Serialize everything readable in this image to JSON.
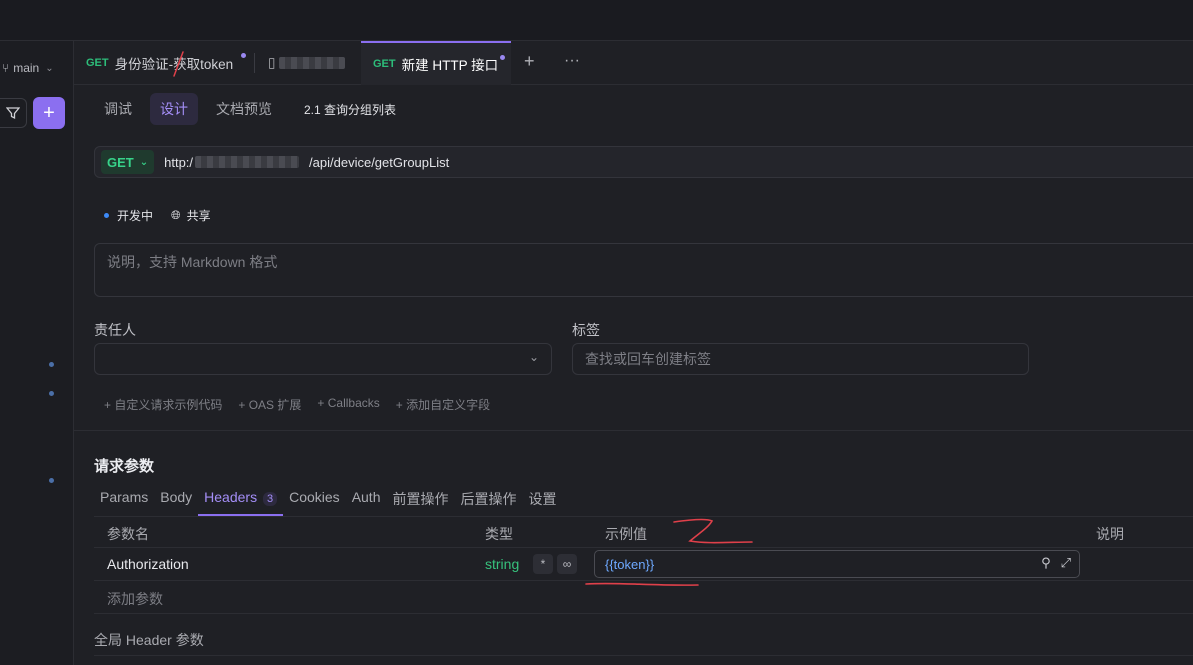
{
  "sidebar": {
    "branch": "main",
    "add_label": "+"
  },
  "tabs": [
    {
      "method": "GET",
      "title": "身份验证-获取token"
    },
    {
      "method": "",
      "title": ""
    },
    {
      "method": "GET",
      "title": "新建 HTTP 接口"
    }
  ],
  "tab_actions": {
    "add": "+",
    "more": "···"
  },
  "subtabs": [
    "调试",
    "设计",
    "文档预览"
  ],
  "breadcrumb": "2.1 查询分组列表",
  "request": {
    "method": "GET",
    "url_prefix": "http:/",
    "url_path": "/api/device/getGroupList"
  },
  "status": {
    "state": "开发中",
    "share": "共享"
  },
  "description_placeholder": "说明，支持 Markdown 格式",
  "owner_label": "责任人",
  "tags_label": "标签",
  "tags_placeholder": "查找或回车创建标签",
  "extras": [
    "自定义请求示例代码",
    "OAS 扩展",
    "Callbacks",
    "添加自定义字段"
  ],
  "section_title": "请求参数",
  "param_tabs": [
    {
      "label": "Params"
    },
    {
      "label": "Body"
    },
    {
      "label": "Headers",
      "count": "3"
    },
    {
      "label": "Cookies"
    },
    {
      "label": "Auth"
    },
    {
      "label": "前置操作"
    },
    {
      "label": "后置操作"
    },
    {
      "label": "设置"
    }
  ],
  "table": {
    "headers": [
      "参数名",
      "类型",
      "示例值",
      "说明"
    ],
    "rows": [
      {
        "name": "Authorization",
        "type": "string",
        "required": "*",
        "example": "{{token}}"
      }
    ],
    "add_label": "添加参数"
  },
  "global_header": "全局 Header 参数",
  "colors": {
    "accent": "#8b6ff0",
    "get": "#2dbd7a",
    "annotation": "#e0404a"
  }
}
